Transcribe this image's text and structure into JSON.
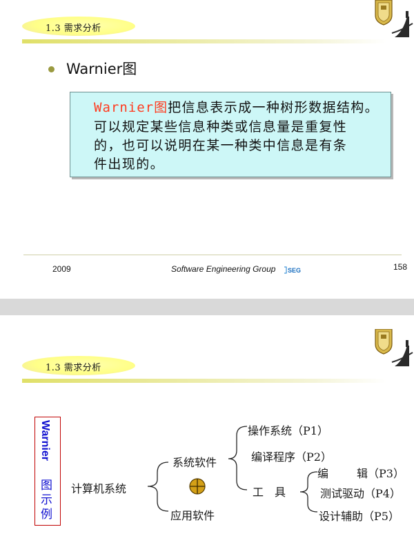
{
  "slide1": {
    "section": "1.3 需求分析",
    "bullet": "Warnier图",
    "definition": {
      "term": "Warnier图",
      "line1_rest": "把信息表示成一种树形数据结构。",
      "line2": "可以规定某些信息种类或信息量是重复性",
      "line3": "的，也可以说明在某一种类中信息是有条",
      "line4": "件出现的。"
    },
    "footer": {
      "year": "2009",
      "group": "Software Engineering Group",
      "logo": "SEG",
      "page": "158"
    }
  },
  "slide2": {
    "section": "1.3 需求分析",
    "side_title_en": "Warnier",
    "side_title_cn": [
      "图",
      "示",
      "例"
    ],
    "tree": {
      "root": "计算机系统",
      "system_software": "系统软件",
      "application_software": "应用软件",
      "os": "操作系统（P1）",
      "compiler": "编译程序（P2）",
      "tools": "工　具",
      "editor_a": "编",
      "editor_b": "辑（P3）",
      "test_driver": "测试驱动（P4）",
      "design_aid": "设计辅助（P5）"
    }
  },
  "colors": {
    "term_red": "#ff3b1f",
    "box_cyan": "#cdf7f7",
    "side_blue": "#1010d0",
    "side_border": "#c00000",
    "oplus_fill": "#d4a017"
  }
}
